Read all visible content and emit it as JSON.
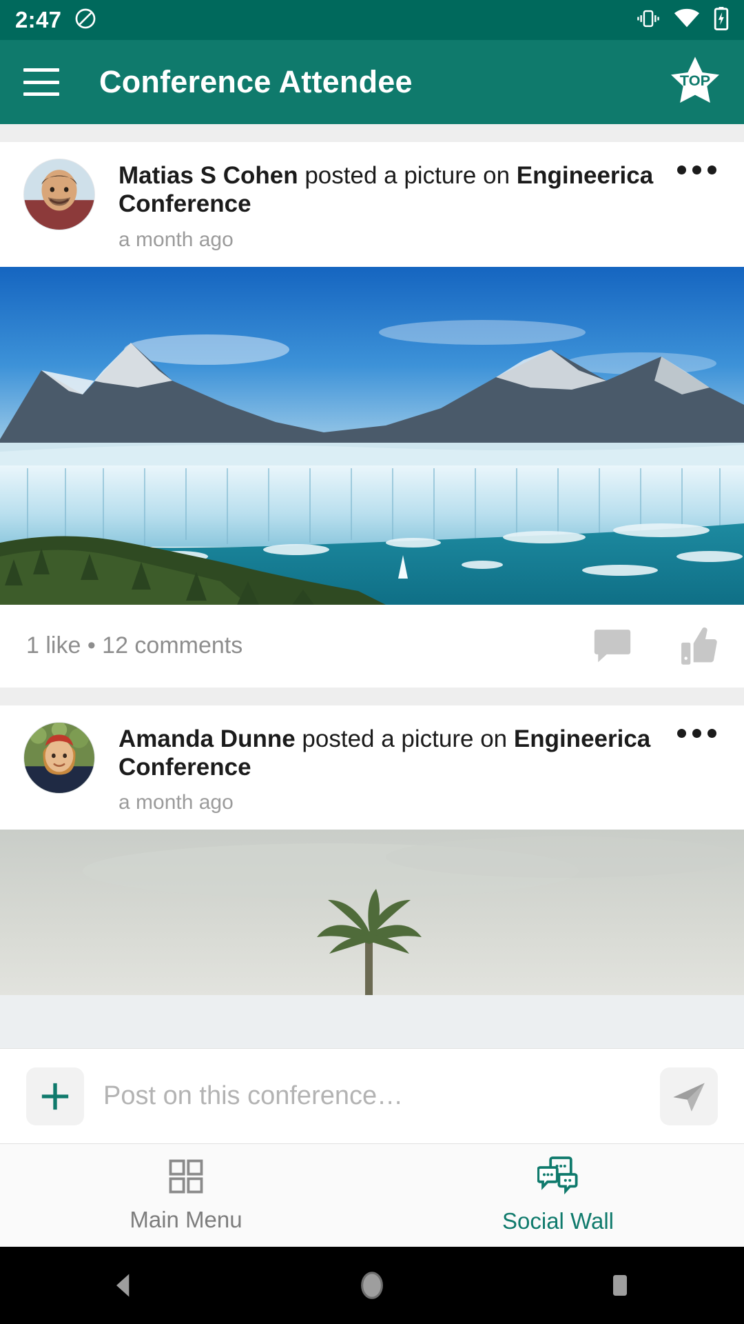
{
  "status_bar": {
    "clock": "2:47",
    "icons": [
      "do-not-disturb-icon",
      "vibrate-icon",
      "wifi-icon",
      "battery-charging-icon"
    ]
  },
  "app_bar": {
    "menu_icon": "hamburger-menu-icon",
    "title": "Conference Attendee",
    "action_icon": "top-star-badge-icon",
    "action_label": "TOP",
    "background_color": "#0f7a6c"
  },
  "feed": {
    "posts": [
      {
        "author": "Matias S Cohen",
        "action": " posted a picture on ",
        "target": "Engineerica Conference",
        "timestamp": "a month ago",
        "avatar_name": "avatar-matias-s-cohen",
        "media_name": "post-image-glacier",
        "stats": "1 like • 12 comments",
        "likes": 1,
        "comments": 12,
        "comment_icon": "comment-bubble-icon",
        "like_icon": "thumbs-up-icon",
        "menu_icon": "post-overflow-menu-icon"
      },
      {
        "author": "Amanda Dunne",
        "action": " posted a picture on ",
        "target": "Engineerica Conference",
        "timestamp": "a month ago",
        "avatar_name": "avatar-amanda-dunne",
        "media_name": "post-image-beach-palm",
        "menu_icon": "post-overflow-menu-icon"
      }
    ]
  },
  "composer": {
    "add_icon": "plus-icon",
    "placeholder": "Post on this conference…",
    "value": "",
    "send_icon": "send-paper-plane-icon",
    "accent_color": "#0f7a6c"
  },
  "tab_bar": {
    "tabs": [
      {
        "label": "Main Menu",
        "icon": "grid-apps-icon",
        "active": false
      },
      {
        "label": "Social Wall",
        "icon": "chat-bubbles-icon",
        "active": true
      }
    ],
    "active_color": "#0f7a6c",
    "inactive_color": "#7d7d7d"
  },
  "system_nav": {
    "back": "back-triangle-icon",
    "home": "home-circle-icon",
    "recents": "recents-square-icon"
  }
}
